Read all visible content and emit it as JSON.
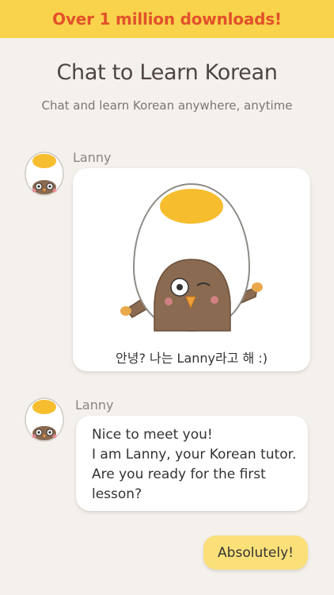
{
  "banner": {
    "text": "Over 1 million downloads!"
  },
  "header": {
    "title": "Chat to Learn Korean",
    "subtitle": "Chat and learn Korean anywhere, anytime"
  },
  "messages": [
    {
      "sender": "Lanny",
      "caption": "안녕? 나는 Lanny라고 해 :)"
    },
    {
      "sender": "Lanny",
      "lines": [
        "Nice to meet you!",
        "I am Lanny, your Korean tutor.",
        "Are you ready for the first",
        "lesson?"
      ]
    }
  ],
  "reply": {
    "label": "Absolutely!"
  },
  "colors": {
    "banner_bg": "#f9d34c",
    "banner_text": "#e2512a",
    "background": "#f4f0ec",
    "reply_bubble": "#fbe07a"
  },
  "icons": {
    "avatar": "egg-owl-avatar",
    "sticker": "egg-owl-waving-sticker"
  }
}
